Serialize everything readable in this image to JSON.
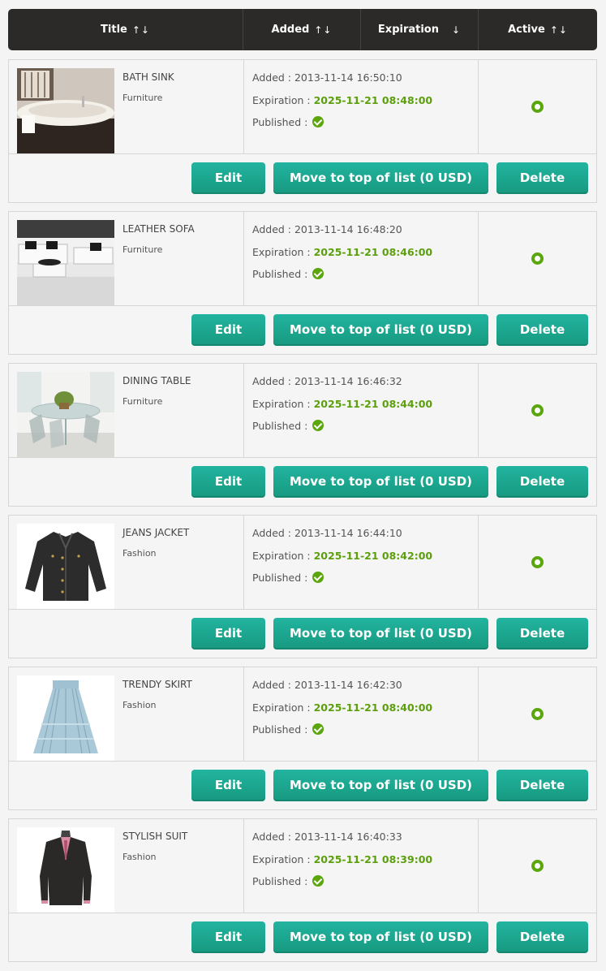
{
  "header": {
    "title": "Title",
    "title_sort": "↑↓",
    "added": "Added",
    "added_sort": "↑↓",
    "expiration": "Expiration",
    "expiration_sort": "↓",
    "active": "Active",
    "active_sort": "↑↓"
  },
  "labels": {
    "added": "Added : ",
    "expiration": "Expiration : ",
    "published": "Published : ",
    "edit": "Edit",
    "move": "Move to top of list (0 USD)",
    "delete": "Delete"
  },
  "items": [
    {
      "name": "BATH SINK",
      "category": "Furniture",
      "added": "2013-11-14 16:50:10",
      "expiration": "2025-11-21 08:48:00",
      "thumb": "bath-sink-image"
    },
    {
      "name": "LEATHER SOFA",
      "category": "Furniture",
      "added": "2013-11-14 16:48:20",
      "expiration": "2025-11-21 08:46:00",
      "thumb": "leather-sofa-image"
    },
    {
      "name": "DINING TABLE",
      "category": "Furniture",
      "added": "2013-11-14 16:46:32",
      "expiration": "2025-11-21 08:44:00",
      "thumb": "dining-table-image"
    },
    {
      "name": "JEANS JACKET",
      "category": "Fashion",
      "added": "2013-11-14 16:44:10",
      "expiration": "2025-11-21 08:42:00",
      "thumb": "jeans-jacket-image"
    },
    {
      "name": "TRENDY SKIRT",
      "category": "Fashion",
      "added": "2013-11-14 16:42:30",
      "expiration": "2025-11-21 08:40:00",
      "thumb": "trendy-skirt-image"
    },
    {
      "name": "STYLISH SUIT",
      "category": "Fashion",
      "added": "2013-11-14 16:40:33",
      "expiration": "2025-11-21 08:39:00",
      "thumb": "stylish-suit-image"
    }
  ],
  "colors": {
    "header_bg": "#2b2a28",
    "button": "#1aa68d",
    "expiration_green": "#5c9f0d",
    "status_green": "#5aa60c"
  }
}
